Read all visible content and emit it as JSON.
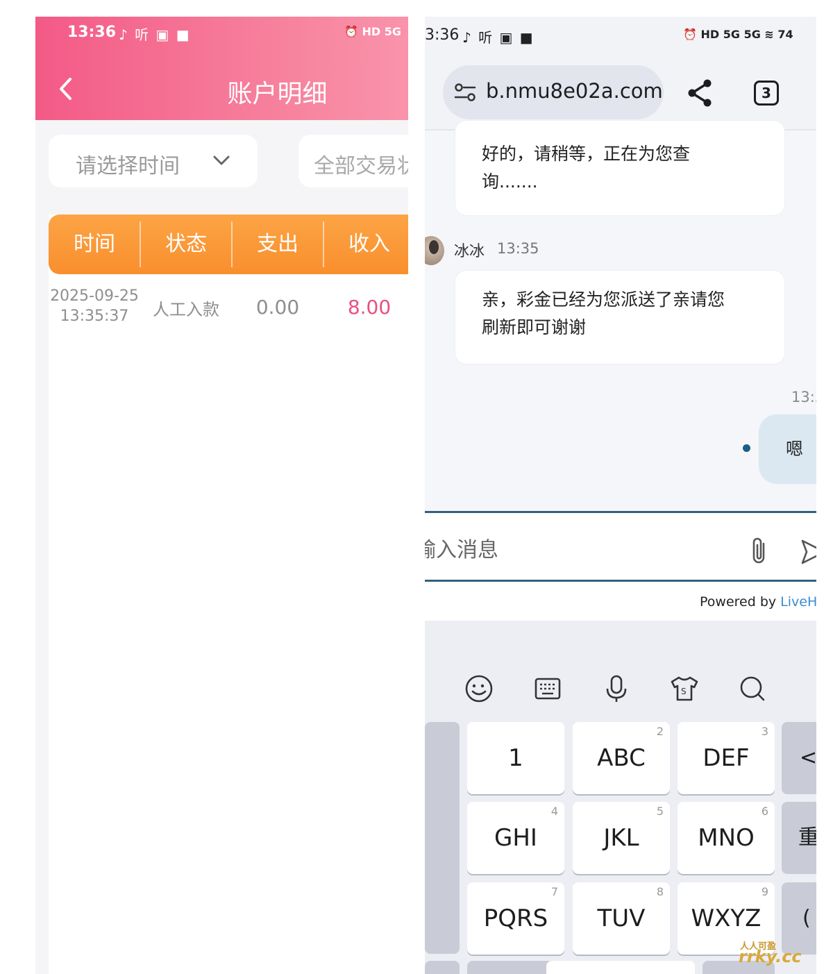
{
  "left": {
    "status_bar": {
      "time": "13:36",
      "icons": "♪ 听 ▣ ■",
      "right_icons": "⏰ HD 5G"
    },
    "header": {
      "title": "账户明细",
      "back_icon": "chevron-left-icon"
    },
    "filters": {
      "time_placeholder": "请选择时间",
      "type_placeholder": "全部交易状"
    },
    "table": {
      "headers": [
        "时间",
        "状态",
        "支出",
        "收入"
      ],
      "rows": [
        {
          "date": "2025-09-25",
          "time": "13:35:37",
          "status": "人工入款",
          "out": "0.00",
          "in": "8.00"
        }
      ]
    },
    "colors": {
      "header_start": "#f35a86",
      "header_end": "#f993ab",
      "table_head": "#fb9a38",
      "income": "#e9507e"
    }
  },
  "right": {
    "status_bar": {
      "time": "3:36",
      "icons": "♪ 听 ▣ ■",
      "right_icons": "⏰ HD 5G 5G ≋ 74"
    },
    "browser": {
      "url": "b.nmu8e02a.com",
      "tab_count": "3"
    },
    "chat": {
      "messages": [
        {
          "from": "agent",
          "text_line1": "好的，请稍等，正在为您查",
          "text_line2": "询......."
        },
        {
          "from": "agent",
          "name": "冰冰",
          "time": "13:35",
          "text_line1": "亲，彩金已经为您派送了亲请您",
          "text_line2": "刷新即可谢谢"
        },
        {
          "from": "user",
          "time": "13:3",
          "text": "嗯"
        }
      ],
      "input_placeholder": "输入消息",
      "powered_by": "Powered by ",
      "powered_brand": "LiveHel"
    },
    "keyboard": {
      "keys": [
        {
          "label": "1",
          "num": ""
        },
        {
          "label": "ABC",
          "num": "2"
        },
        {
          "label": "DEF",
          "num": "3"
        },
        {
          "label": "GHI",
          "num": "4"
        },
        {
          "label": "JKL",
          "num": "5"
        },
        {
          "label": "MNO",
          "num": "6"
        },
        {
          "label": "PQRS",
          "num": "7"
        },
        {
          "label": "TUV",
          "num": "8"
        },
        {
          "label": "WXYZ",
          "num": "9"
        }
      ],
      "side_keys": [
        "<",
        "重",
        "("
      ]
    }
  },
  "watermark": {
    "line1": "人人可盈",
    "line2": "rrky.cc"
  }
}
